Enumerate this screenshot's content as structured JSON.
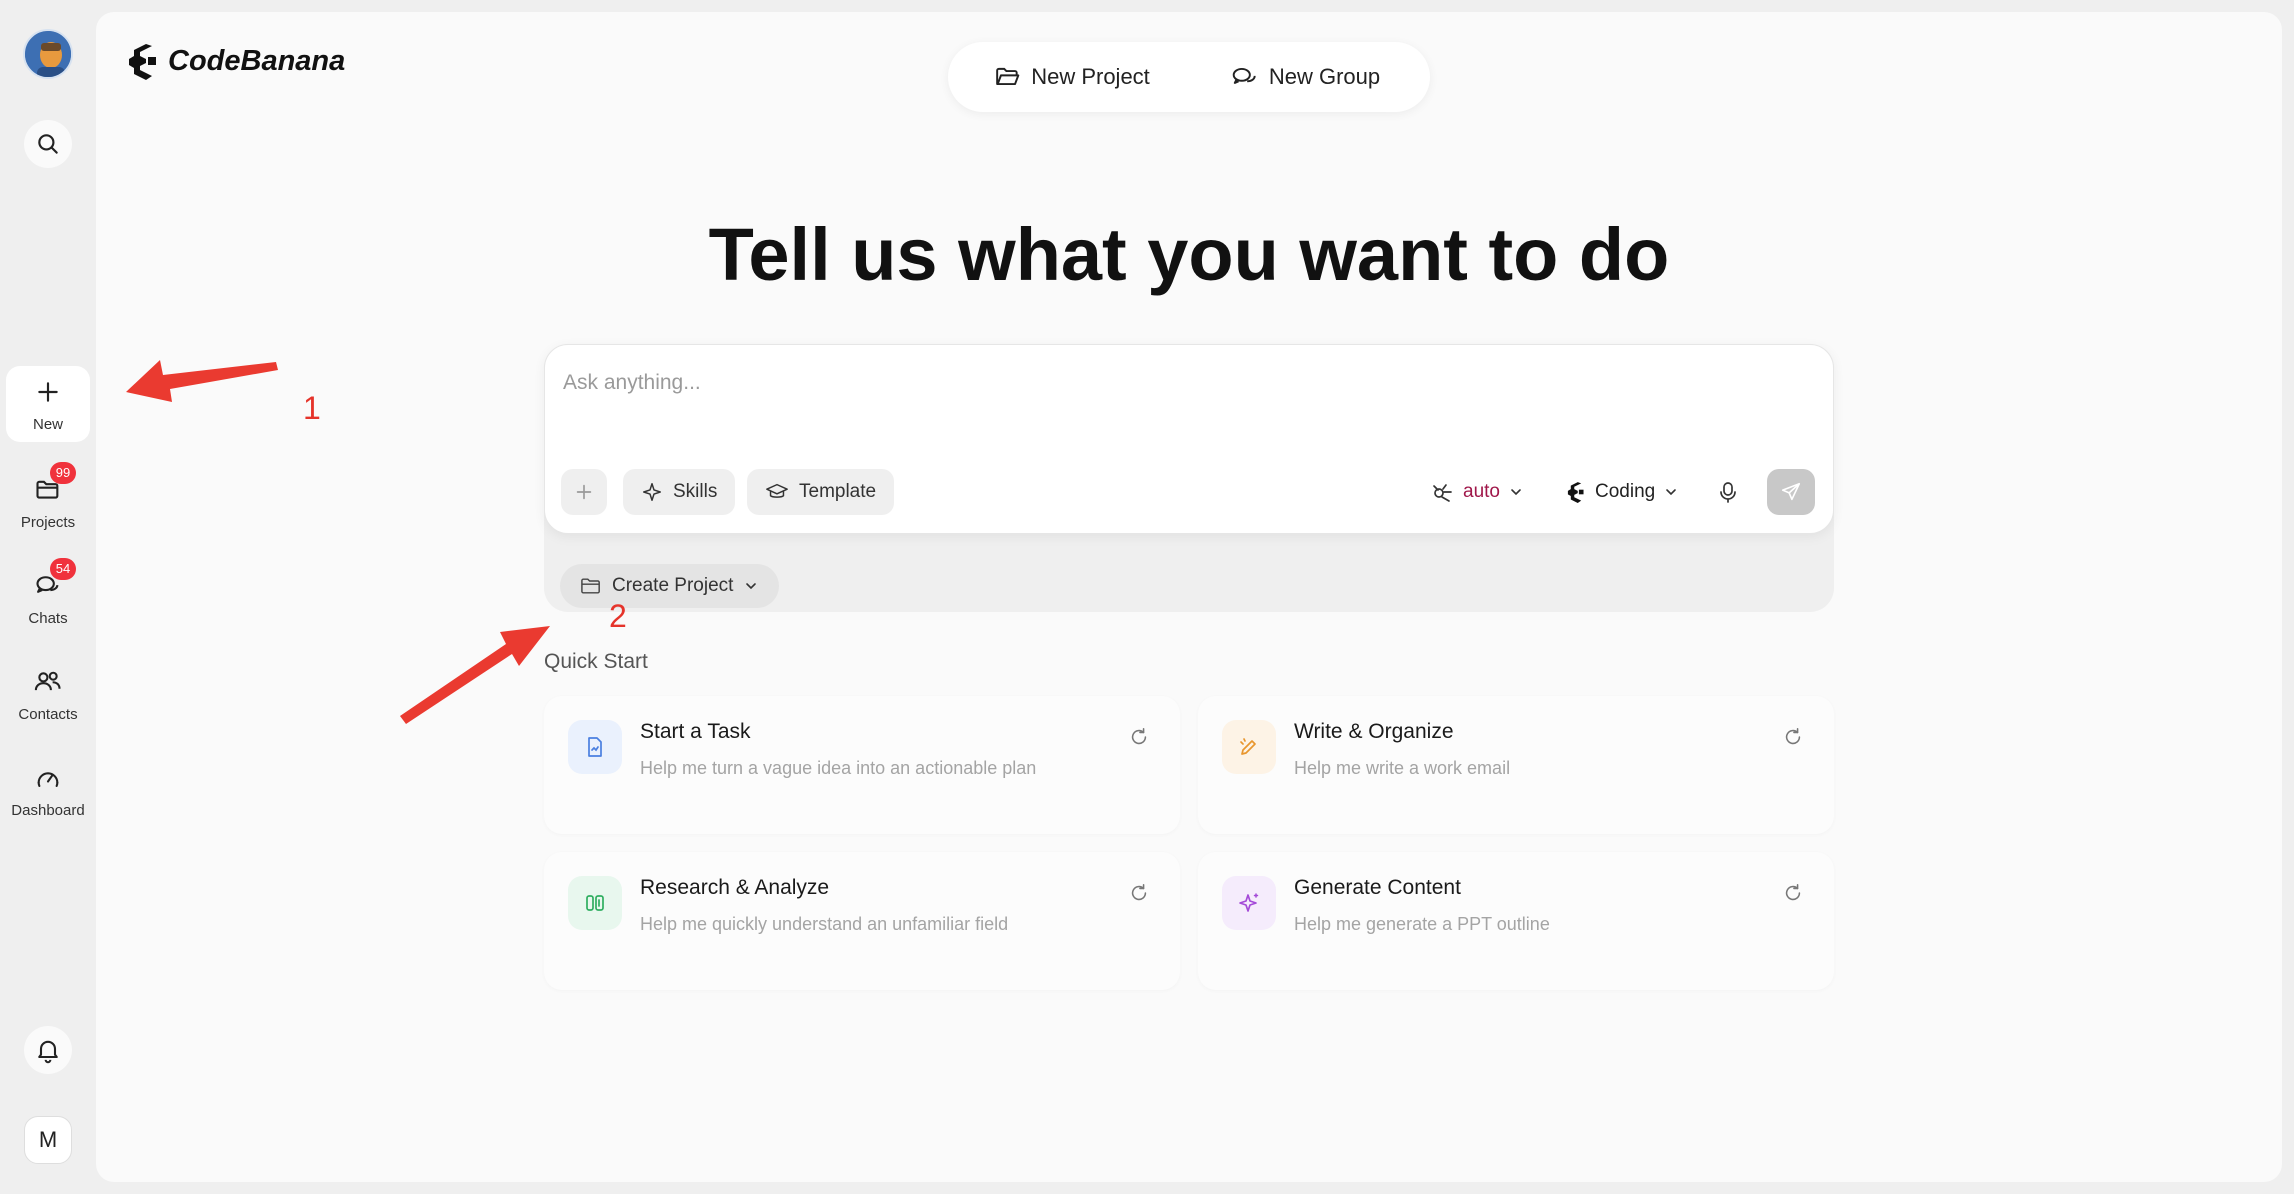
{
  "sidebar": {
    "new_label": "New",
    "projects_label": "Projects",
    "projects_badge": "99",
    "chats_label": "Chats",
    "chats_badge": "54",
    "contacts_label": "Contacts",
    "dashboard_label": "Dashboard",
    "user_initial": "M"
  },
  "header": {
    "logo_text": "CodeBanana",
    "new_project_label": "New Project",
    "new_group_label": "New Group"
  },
  "main": {
    "headline": "Tell us what you want to do",
    "prompt": {
      "placeholder": "Ask anything...",
      "value": "",
      "skills_label": "Skills",
      "template_label": "Template",
      "model_value": "auto",
      "mode_value": "Coding",
      "create_project_label": "Create Project"
    },
    "quick_start": {
      "title": "Quick Start",
      "cards": [
        {
          "title": "Start a Task",
          "desc": "Help me turn a vague idea into an actionable plan",
          "icon": "document-edit-icon"
        },
        {
          "title": "Write & Organize",
          "desc": "Help me write a work email",
          "icon": "pen-icon"
        },
        {
          "title": "Research & Analyze",
          "desc": "Help me quickly understand an unfamiliar field",
          "icon": "columns-icon"
        },
        {
          "title": "Generate Content",
          "desc": "Help me generate a PPT outline",
          "icon": "sparkle-icon"
        }
      ]
    }
  },
  "annotations": {
    "marker_1": "1",
    "marker_2": "2"
  },
  "colors": {
    "accent_auto": "#a0174a",
    "badge": "#f0323c",
    "arrow": "#e5332a"
  }
}
